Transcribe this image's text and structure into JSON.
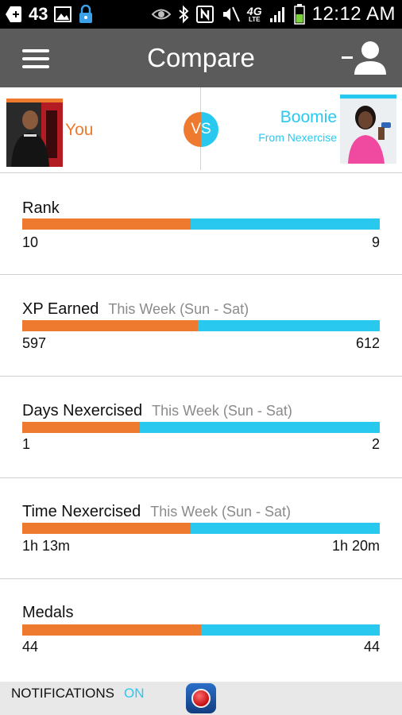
{
  "status_bar": {
    "notification_count": "43",
    "time": "12:12 AM",
    "network_label": "4G",
    "network_sub": "LTE"
  },
  "app_bar": {
    "title": "Compare"
  },
  "versus": {
    "me": {
      "name": "You",
      "color": "#ee7a2f"
    },
    "them": {
      "name": "Boomie",
      "subtitle": "From Nexercise",
      "color": "#29c9ef"
    },
    "vs_label": "VS"
  },
  "stats": [
    {
      "label": "Rank",
      "sub": "",
      "left_value": "10",
      "right_value": "9",
      "left_share": 0.471
    },
    {
      "label": "XP Earned",
      "sub": "This Week (Sun - Sat)",
      "left_value": "597",
      "right_value": "612",
      "left_share": 0.49
    },
    {
      "label": "Days Nexercised",
      "sub": "This Week (Sun - Sat)",
      "left_value": "1",
      "right_value": "2",
      "left_share": 0.329
    },
    {
      "label": "Time Nexercised",
      "sub": "This Week (Sun - Sat)",
      "left_value": "1h 13m",
      "right_value": "1h 20m",
      "left_share": 0.471
    },
    {
      "label": "Medals",
      "sub": "",
      "left_value": "44",
      "right_value": "44",
      "left_share": 0.5
    }
  ],
  "bottom_bar": {
    "notifications_label": "NOTIFICATIONS",
    "notifications_state": "ON"
  },
  "colors": {
    "accent_orange": "#ee7a2f",
    "accent_blue": "#29c9ef",
    "app_bar": "#5b5b5b"
  }
}
